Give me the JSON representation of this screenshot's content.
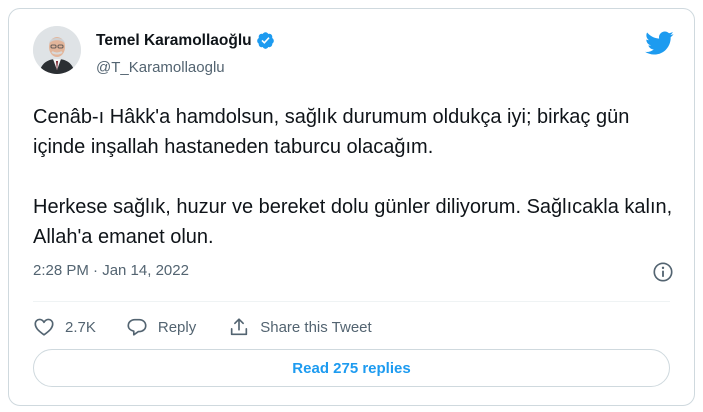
{
  "author": {
    "name": "Temel Karamollaoğlu",
    "handle": "@T_Karamollaoglu",
    "verified": true,
    "avatar_icon": "profile-photo"
  },
  "tweet": {
    "paragraphs": [
      "Cenâb-ı Hâkk'a hamdolsun, sağlık durumum oldukça iyi; birkaç gün içinde inşallah hastaneden taburcu olacağım.",
      "Herkese sağlık, huzur ve bereket dolu günler diliyorum. Sağlıcakla kalın, Allah'a emanet olun."
    ],
    "timestamp": "2:28 PM · Jan 14, 2022"
  },
  "actions": {
    "like_count": "2.7K",
    "reply_label": "Reply",
    "share_label": "Share this Tweet"
  },
  "read_replies_label": "Read 275 replies",
  "colors": {
    "accent": "#1d9bf0",
    "text": "#0f1419",
    "secondary": "#536471",
    "border": "#cfd9de"
  },
  "icons": [
    "verified-badge-icon",
    "twitter-bird-icon",
    "info-icon",
    "heart-icon",
    "reply-bubble-icon",
    "share-icon"
  ]
}
